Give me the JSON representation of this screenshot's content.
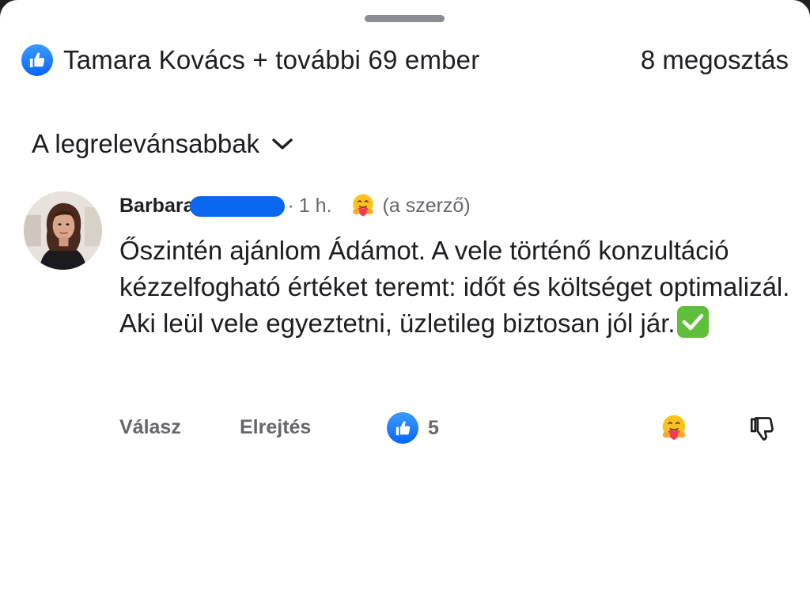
{
  "reactions": {
    "reactors_text": "Tamara Kovács + további 69 ember",
    "shares_text": "8 megosztás",
    "like_icon": "like-thumb-icon"
  },
  "sort": {
    "label": "A legrelevánsabbak",
    "icon": "chevron-down-icon"
  },
  "comment": {
    "author": "Barbara",
    "separator": "·",
    "time": "1 h.",
    "reaction_emoji": "hugging-face-emoji",
    "author_tag": "(a szerző)",
    "text": "Őszintén ajánlom Ádámot. A vele történő konzultáció kézzelfogható értéket teremt: időt és költséget optimalizál. Aki leül vele egyeztetni, üzletileg biztosan jól jár.",
    "trailing_emoji": "check-mark-button-emoji",
    "actions": {
      "reply": "Válasz",
      "hide": "Elrejtés",
      "like_count": "5"
    }
  },
  "colors": {
    "facebook_blue": "#0866ff",
    "text_primary": "#1c1e21",
    "text_secondary": "#65676b",
    "check_green": "#5fbf3a"
  }
}
